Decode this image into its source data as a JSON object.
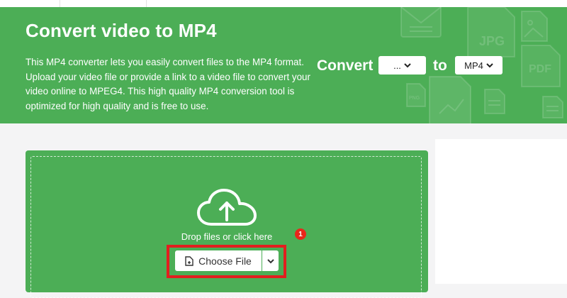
{
  "hero": {
    "title": "Convert video to MP4",
    "description": "This MP4 converter lets you easily convert files to the MP4 format. Upload your video file or provide a link to a video file to convert your video online to MPEG4. This high quality MP4 conversion tool is optimized for high quality and is free to use.",
    "background_color": "#4cae56"
  },
  "converter": {
    "convert_label": "Convert",
    "from_value": "...",
    "to_label": "to",
    "to_value": "MP4"
  },
  "upload": {
    "cloud_icon": "cloud-upload-icon",
    "drop_text": "Drop files or click here",
    "badge": "1",
    "choose_label": "Choose File",
    "file_icon": "file-add-icon",
    "dropdown_icon": "chevron-down-icon",
    "highlight_color": "#e21f1f"
  },
  "decor": {
    "icons": [
      "mail-icon",
      "jpg-file-icon",
      "image-file-icon",
      "pdf-file-icon",
      "png-file-icon",
      "chart-file-icon",
      "doc-file-icon"
    ]
  }
}
